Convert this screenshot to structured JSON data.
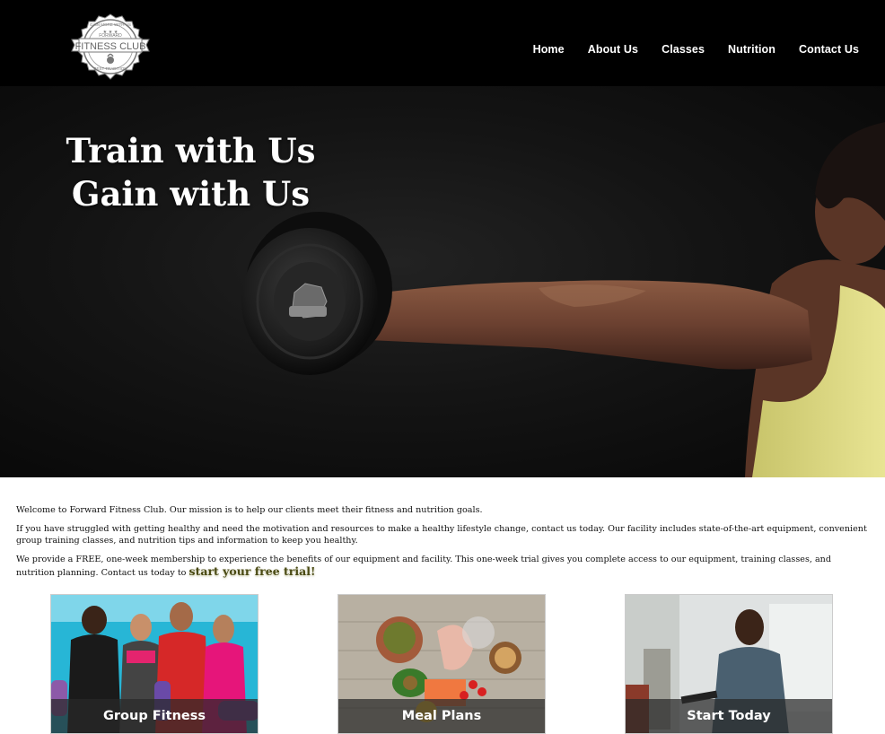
{
  "header": {
    "logo": {
      "text_top": "GAIN MORE WITH US",
      "text_brand_small": "FORWARD",
      "text_brand": "FITNESS CLUB",
      "text_bottom": "BEST TRADITION"
    },
    "nav": [
      {
        "label": "Home"
      },
      {
        "label": "About Us"
      },
      {
        "label": "Classes"
      },
      {
        "label": "Nutrition"
      },
      {
        "label": "Contact Us"
      }
    ]
  },
  "hero": {
    "line1": "Train with Us",
    "line2": "Gain with Us"
  },
  "content": {
    "p1": "Welcome to Forward Fitness Club. Our mission is to help our clients meet their fitness and nutrition goals.",
    "p2": "If you have struggled with getting healthy and need the motivation and resources to make a healthy lifestyle change, contact us today. Our facility includes state-of-the-art equipment, convenient group training classes, and nutrition tips and information to keep you healthy.",
    "p3": "We provide a FREE, one-week membership to experience the benefits of our equipment and facility. This one-week trial gives you complete access to our equipment, training classes, and nutrition planning. Contact us today to",
    "cta": "start your free trial!"
  },
  "cards": [
    {
      "label": "Group Fitness"
    },
    {
      "label": "Meal Plans"
    },
    {
      "label": "Start Today"
    }
  ]
}
